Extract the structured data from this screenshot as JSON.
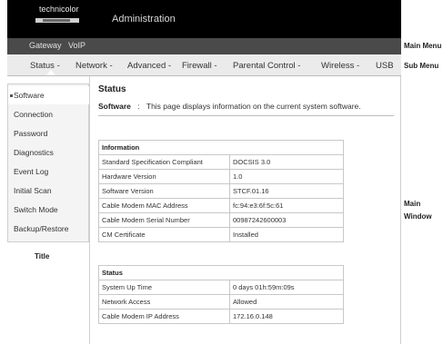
{
  "header": {
    "logo_text": "technicolor",
    "title": "Administration"
  },
  "main_menu": {
    "items": [
      "Gateway",
      "VoIP"
    ]
  },
  "sub_menu": {
    "items": [
      "Status -",
      "Network -",
      "Advanced -",
      "Firewall -",
      "Parental Control -",
      "Wireless -",
      "USB"
    ]
  },
  "annotations": {
    "main_menu": "Main Menu",
    "sub_menu": "Sub Menu",
    "main_window_1": "Main",
    "main_window_2": "Window",
    "title": "Title"
  },
  "sidebar": {
    "items": [
      "Software",
      "Connection",
      "Password",
      "Diagnostics",
      "Event Log",
      "Initial Scan",
      "Switch Mode",
      "Backup/Restore"
    ],
    "active_index": 0
  },
  "content": {
    "title": "Status",
    "desc_label": "Software",
    "desc_sep": ":",
    "desc_text": "This page displays information on the current system software."
  },
  "info_table": {
    "header": "Information",
    "rows": [
      [
        "Standard Specification Compliant",
        "DOCSIS 3.0"
      ],
      [
        "Hardware Version",
        "1.0"
      ],
      [
        "Software Version",
        "STCF.01.16"
      ],
      [
        "Cable Modem MAC Address",
        "fc:94:e3:6f:5c:61"
      ],
      [
        "Cable Modem Serial Number",
        "00987242600003"
      ],
      [
        "CM Certificate",
        "Installed"
      ]
    ]
  },
  "status_table": {
    "header": "Status",
    "rows": [
      [
        "System Up Time",
        "0 days 01h:59m:09s"
      ],
      [
        "Network Access",
        "Allowed"
      ],
      [
        "Cable Modem IP Address",
        "172.16.0.148"
      ]
    ]
  }
}
